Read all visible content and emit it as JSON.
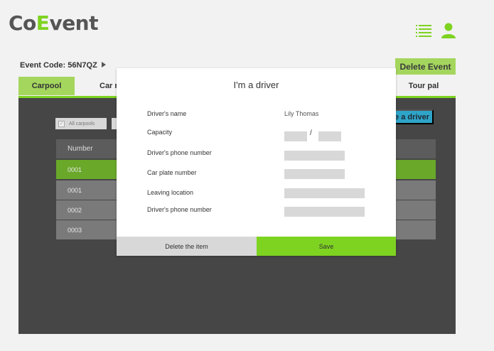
{
  "app": {
    "logo_prefix": "Co",
    "logo_accent": "E",
    "logo_suffix": "vent",
    "accent_color": "#7ed321"
  },
  "header": {
    "menu_icon": "list-menu-icon",
    "user_icon": "user-icon"
  },
  "event": {
    "code_label": "Event Code: 56N7QZ",
    "delete_label": "Delete Event"
  },
  "tabs": [
    {
      "label": "Carpool",
      "active": true
    },
    {
      "label": "Car re"
    },
    {
      "label": "Tour pal"
    }
  ],
  "panel": {
    "filter_label": "All carpools",
    "be_driver_label": "me a driver",
    "table": {
      "header": "Number",
      "rows": [
        "0001",
        "0001",
        "0002",
        "0003"
      ]
    }
  },
  "modal": {
    "title": "I'm a driver",
    "fields": [
      {
        "label": "Driver's name",
        "value": "Lily Thomas"
      },
      {
        "label": "Capacity",
        "separator": "/"
      },
      {
        "label": "Driver's phone number"
      },
      {
        "label": "Car plate number"
      },
      {
        "label": "Leaving location"
      },
      {
        "label": "Driver's phone number"
      }
    ],
    "delete_label": "Delete the item",
    "save_label": "Save"
  }
}
